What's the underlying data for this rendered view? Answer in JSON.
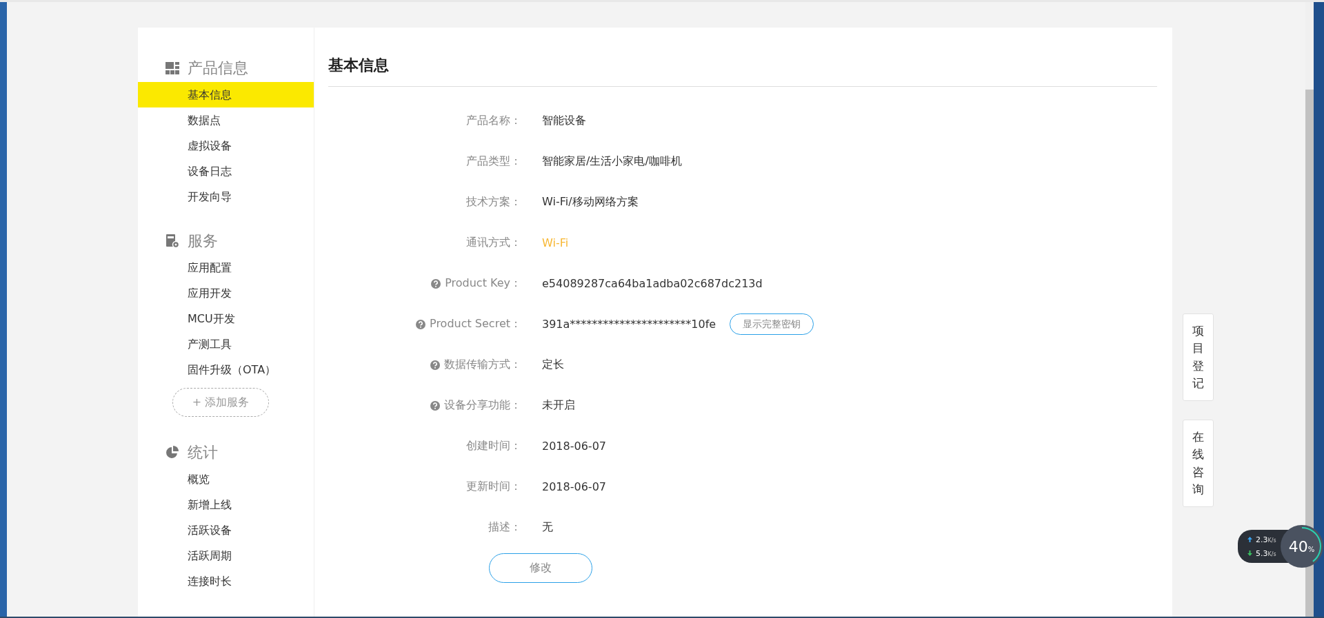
{
  "sidebar": {
    "sections": [
      {
        "title": "产品信息",
        "items": [
          {
            "label": "基本信息",
            "selected": true
          },
          {
            "label": "数据点",
            "selected": false
          },
          {
            "label": "虚拟设备",
            "selected": false
          },
          {
            "label": "设备日志",
            "selected": false
          },
          {
            "label": "开发向导",
            "selected": false
          }
        ]
      },
      {
        "title": "服务",
        "items": [
          {
            "label": "应用配置",
            "selected": false
          },
          {
            "label": "应用开发",
            "selected": false
          },
          {
            "label": "MCU开发",
            "selected": false
          },
          {
            "label": "产测工具",
            "selected": false
          },
          {
            "label": "固件升级（OTA）",
            "selected": false
          }
        ],
        "add_button": "+ 添加服务"
      },
      {
        "title": "统计",
        "items": [
          {
            "label": "概览",
            "selected": false
          },
          {
            "label": "新增上线",
            "selected": false
          },
          {
            "label": "活跃设备",
            "selected": false
          },
          {
            "label": "活跃周期",
            "selected": false
          },
          {
            "label": "连接时长",
            "selected": false
          }
        ]
      }
    ]
  },
  "content": {
    "title": "基本信息",
    "fields": [
      {
        "label": "产品名称：",
        "help": false,
        "kind": "text",
        "value": "智能设备"
      },
      {
        "label": "产品类型：",
        "help": false,
        "kind": "text",
        "value": "智能家居/生活小家电/咖啡机"
      },
      {
        "label": "技术方案：",
        "help": false,
        "kind": "text",
        "value": "Wi-Fi/移动网络方案"
      },
      {
        "label": "通讯方式：",
        "help": false,
        "kind": "accent",
        "value": "Wi-Fi"
      },
      {
        "label": "Product Key：",
        "help": true,
        "kind": "text",
        "value": "e54089287ca64ba1adba02c687dc213d"
      },
      {
        "label": "Product Secret：",
        "help": true,
        "kind": "secret",
        "value": "391a**********************10fe",
        "button": "显示完整密钥"
      },
      {
        "label": "数据传输方式：",
        "help": true,
        "kind": "text",
        "value": "定长"
      },
      {
        "label": "设备分享功能：",
        "help": true,
        "kind": "text",
        "value": "未开启"
      },
      {
        "label": "创建时间：",
        "help": false,
        "kind": "text",
        "value": "2018-06-07"
      },
      {
        "label": "更新时间：",
        "help": false,
        "kind": "text",
        "value": "2018-06-07"
      },
      {
        "label": "描述：",
        "help": false,
        "kind": "text",
        "value": "无"
      }
    ],
    "edit_button": "修改"
  },
  "side_buttons": [
    "项目登记",
    "在线咨询"
  ],
  "speed_widget": {
    "upload": "2.3",
    "upload_unit": "K/s",
    "download": "5.3",
    "download_unit": "K/s",
    "percent": "40",
    "percent_sign": "%",
    "level": 0.4
  }
}
